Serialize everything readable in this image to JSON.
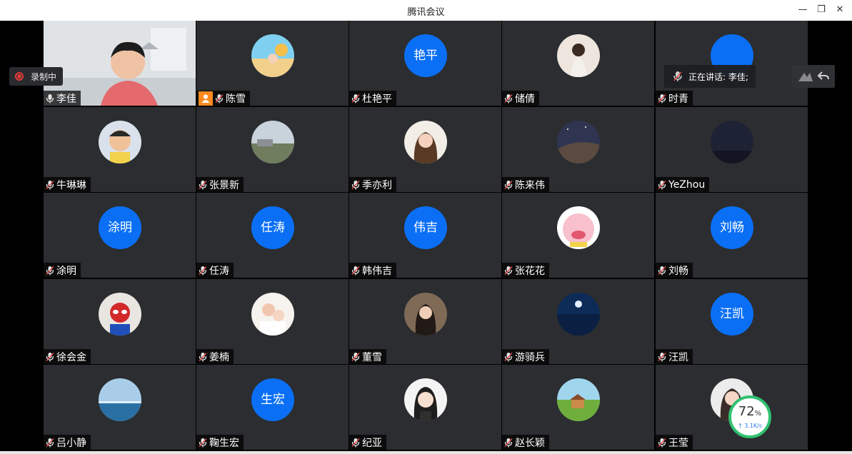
{
  "window": {
    "title": "腾讯会议",
    "minimize": "—",
    "restore": "❐",
    "close": "✕"
  },
  "recording": {
    "label": "录制中"
  },
  "speaking": {
    "label": "正在讲话: 李佳;"
  },
  "network": {
    "percent": "72",
    "percent_unit": "%",
    "speed": "↑ 3.1K/s"
  },
  "participants": [
    {
      "name": "李佳",
      "avatar": "photo-video",
      "host": false,
      "active": true
    },
    {
      "name": "陈雪",
      "avatar": "photo-beach",
      "host": true
    },
    {
      "name": "杜艳平",
      "avatar_text": "艳平"
    },
    {
      "name": "储倩",
      "avatar": "photo-woman"
    },
    {
      "name": "时青",
      "avatar_text": ""
    },
    {
      "name": "牛琳琳",
      "avatar": "photo-child"
    },
    {
      "name": "张景新",
      "avatar": "photo-landscape"
    },
    {
      "name": "季亦利",
      "avatar": "photo-woman2"
    },
    {
      "name": "陈来伟",
      "avatar": "photo-night-sky"
    },
    {
      "name": "YeZhou",
      "avatar": "photo-dark"
    },
    {
      "name": "涂明",
      "avatar_text": "涂明"
    },
    {
      "name": "任涛",
      "avatar_text": "任涛"
    },
    {
      "name": "韩伟吉",
      "avatar_text": "伟吉"
    },
    {
      "name": "张花花",
      "avatar": "photo-cartoon"
    },
    {
      "name": "刘畅",
      "avatar_text": "刘畅"
    },
    {
      "name": "徐会金",
      "avatar": "photo-spiderman"
    },
    {
      "name": "姜楠",
      "avatar": "photo-family"
    },
    {
      "name": "董雪",
      "avatar": "photo-woman3"
    },
    {
      "name": "游骑兵",
      "avatar": "photo-moon-sea"
    },
    {
      "name": "汪凯",
      "avatar_text": "汪凯"
    },
    {
      "name": "吕小静",
      "avatar": "photo-sea"
    },
    {
      "name": "鞠生宏",
      "avatar_text": "生宏"
    },
    {
      "name": "纪亚",
      "avatar": "photo-cartoon-girl"
    },
    {
      "name": "赵长颖",
      "avatar": "photo-village"
    },
    {
      "name": "王莹",
      "avatar": "photo-woman4"
    }
  ]
}
